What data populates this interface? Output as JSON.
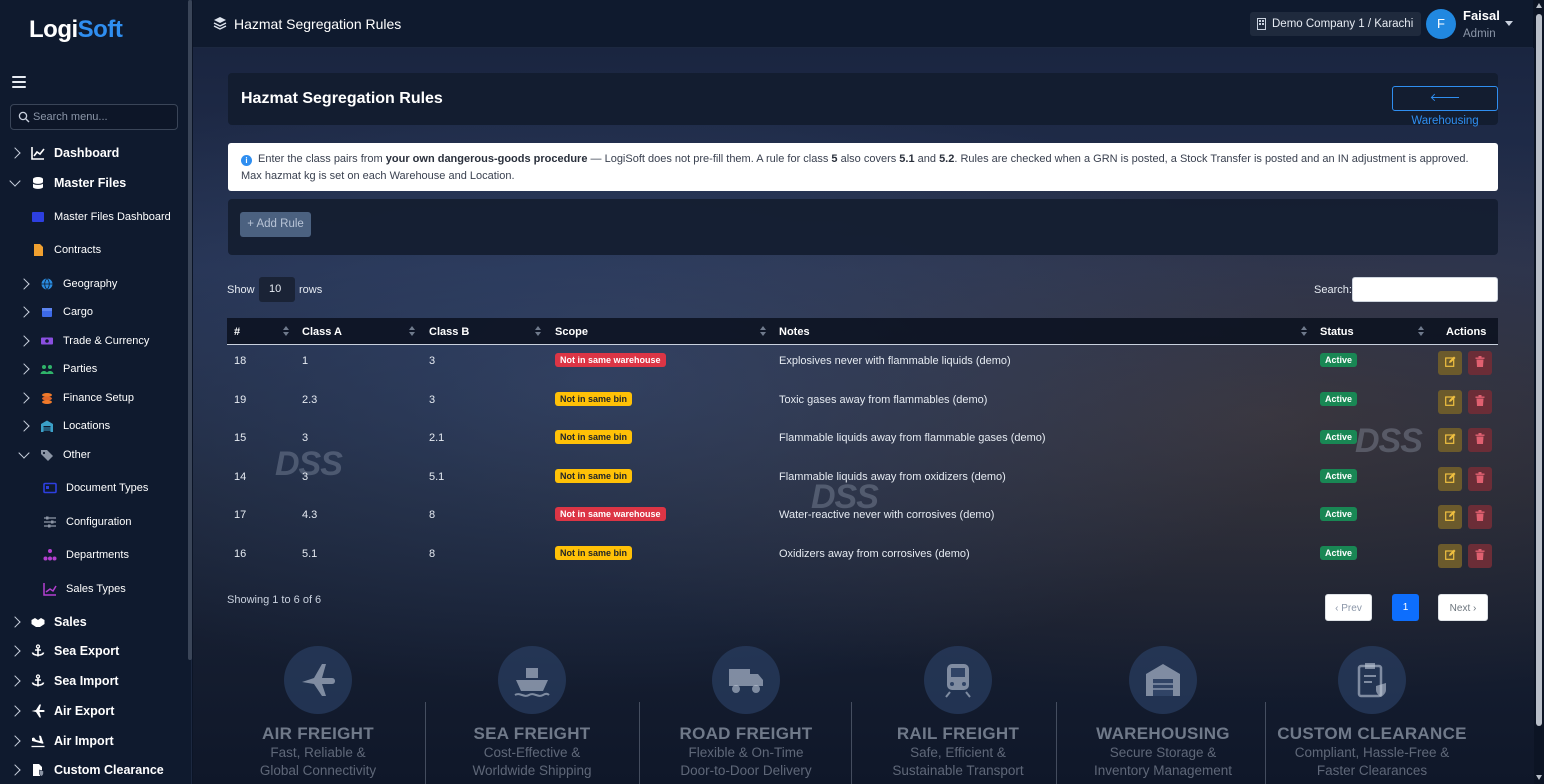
{
  "app": {
    "logo_main": "Logi",
    "logo_accent": "Soft"
  },
  "sidebar": {
    "search_placeholder": "Search menu...",
    "items": [
      {
        "label": "Dashboard",
        "level": "top",
        "icon": "chart-icon"
      },
      {
        "label": "Master Files",
        "level": "top",
        "icon": "database-icon",
        "expanded": true
      },
      {
        "label": "Master Files Dashboard",
        "level": "sub",
        "icon": "dashboard-icon"
      },
      {
        "label": "Contracts",
        "level": "sub",
        "icon": "file-icon"
      },
      {
        "label": "Geography",
        "level": "sub2",
        "icon": "globe-icon"
      },
      {
        "label": "Cargo",
        "level": "sub2",
        "icon": "box-icon"
      },
      {
        "label": "Trade & Currency",
        "level": "sub2",
        "icon": "money-icon"
      },
      {
        "label": "Parties",
        "level": "sub2",
        "icon": "users-icon"
      },
      {
        "label": "Finance Setup",
        "level": "sub2",
        "icon": "coins-icon"
      },
      {
        "label": "Locations",
        "level": "sub2",
        "icon": "warehouse-icon"
      },
      {
        "label": "Other",
        "level": "sub2",
        "icon": "tags-icon",
        "expanded": true
      },
      {
        "label": "Document Types",
        "level": "sub3",
        "icon": "id-card-icon"
      },
      {
        "label": "Configuration",
        "level": "sub3",
        "icon": "sliders-icon"
      },
      {
        "label": "Departments",
        "level": "sub3",
        "icon": "sitemap-icon"
      },
      {
        "label": "Sales Types",
        "level": "sub3",
        "icon": "trend-icon"
      },
      {
        "label": "Sales",
        "level": "top",
        "icon": "handshake-icon"
      },
      {
        "label": "Sea Export",
        "level": "top",
        "icon": "anchor-icon"
      },
      {
        "label": "Sea Import",
        "level": "top",
        "icon": "anchor-icon"
      },
      {
        "label": "Air Export",
        "level": "top",
        "icon": "plane-icon"
      },
      {
        "label": "Air Import",
        "level": "top",
        "icon": "plane-landing-icon"
      },
      {
        "label": "Custom Clearance",
        "level": "top",
        "icon": "file-shield-icon"
      }
    ]
  },
  "header": {
    "title": "Hazmat Segregation Rules",
    "company": "Demo Company 1 / Karachi",
    "user_initial": "F",
    "user_name": "Faisal",
    "user_role": "Admin"
  },
  "card": {
    "title": "Hazmat Segregation Rules",
    "back_label": "Warehousing"
  },
  "info": {
    "p1": "Enter the class pairs from ",
    "b1": "your own dangerous-goods procedure",
    "p2": " — LogiSoft does not pre-fill them. A rule for class ",
    "b2": "5",
    "p3": " also covers ",
    "b3": "5.1",
    "p4": " and ",
    "b4": "5.2",
    "p5": ". Rules are checked when a GRN is posted, a Stock Transfer is posted and an IN adjustment is approved.",
    "line2": "Max hazmat kg is set on each Warehouse and Location."
  },
  "toolbar": {
    "add_label": "+ Add Rule"
  },
  "table_controls": {
    "show_label": "Show",
    "rows_value": "10",
    "rows_label": "rows",
    "search_label": "Search:"
  },
  "table": {
    "columns": [
      "#",
      "Class A",
      "Class B",
      "Scope",
      "Notes",
      "Status",
      "Actions"
    ],
    "rows": [
      {
        "id": "18",
        "class_a": "1",
        "class_b": "3",
        "scope": "Not in same warehouse",
        "scope_color": "#dc3545",
        "notes": "Explosives never with flammable liquids (demo)",
        "status": "Active"
      },
      {
        "id": "19",
        "class_a": "2.3",
        "class_b": "3",
        "scope": "Not in same bin",
        "scope_color": "#ffc107",
        "notes": "Toxic gases away from flammables (demo)",
        "status": "Active"
      },
      {
        "id": "15",
        "class_a": "3",
        "class_b": "2.1",
        "scope": "Not in same bin",
        "scope_color": "#ffc107",
        "notes": "Flammable liquids away from flammable gases (demo)",
        "status": "Active"
      },
      {
        "id": "14",
        "class_a": "3",
        "class_b": "5.1",
        "scope": "Not in same bin",
        "scope_color": "#ffc107",
        "notes": "Flammable liquids away from oxidizers (demo)",
        "status": "Active"
      },
      {
        "id": "17",
        "class_a": "4.3",
        "class_b": "8",
        "scope": "Not in same warehouse",
        "scope_color": "#dc3545",
        "notes": "Water-reactive never with corrosives (demo)",
        "status": "Active"
      },
      {
        "id": "16",
        "class_a": "5.1",
        "class_b": "8",
        "scope": "Not in same bin",
        "scope_color": "#ffc107",
        "notes": "Oxidizers away from corrosives (demo)",
        "status": "Active"
      }
    ]
  },
  "footer": {
    "showing": "Showing 1 to 6 of 6",
    "prev": "‹ Prev",
    "page": "1",
    "next": "Next ›"
  },
  "background": {
    "watermark": "DSS",
    "services": [
      {
        "title": "AIR FREIGHT",
        "line1": "Fast, Reliable &",
        "line2": "Global Connectivity",
        "icon": "plane-icon"
      },
      {
        "title": "SEA FREIGHT",
        "line1": "Cost-Effective &",
        "line2": "Worldwide Shipping",
        "icon": "ship-icon"
      },
      {
        "title": "ROAD FREIGHT",
        "line1": "Flexible & On-Time",
        "line2": "Door-to-Door Delivery",
        "icon": "truck-icon"
      },
      {
        "title": "RAIL FREIGHT",
        "line1": "Safe, Efficient &",
        "line2": "Sustainable Transport",
        "icon": "train-icon"
      },
      {
        "title": "WAREHOUSING",
        "line1": "Secure Storage &",
        "line2": "Inventory Management",
        "icon": "warehouse-icon"
      },
      {
        "title": "CUSTOM CLEARANCE",
        "line1": "Compliant, Hassle-Free &",
        "line2": "Faster Clearances",
        "icon": "clipboard-check-icon"
      }
    ]
  },
  "colors": {
    "accent": "#2f8ef0",
    "active_green": "#198754",
    "danger": "#dc3545",
    "warning": "#ffc107"
  }
}
